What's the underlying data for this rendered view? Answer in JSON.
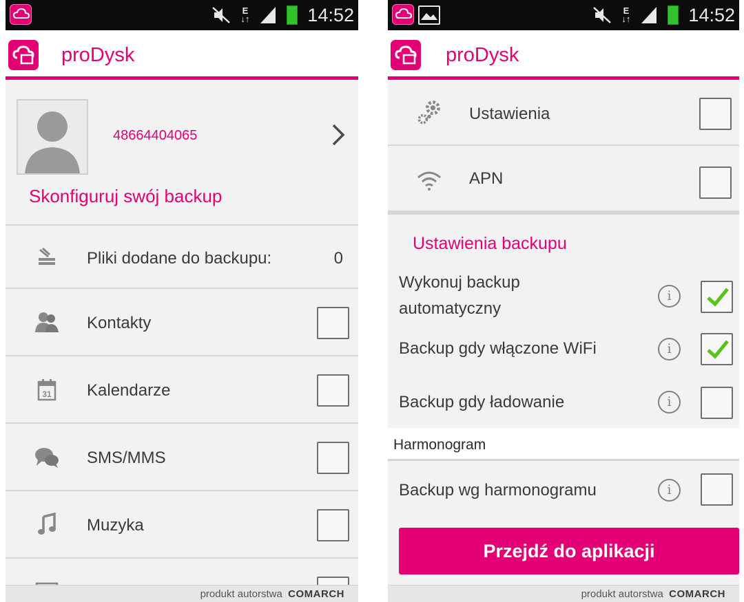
{
  "colors": {
    "accent": "#e20074",
    "background": "#f2f2f2",
    "text": "#3a3a3a",
    "check": "#5ac21a"
  },
  "status_bar": {
    "time": "14:52",
    "network_type": "E",
    "icons": [
      "prodysk-notification-icon",
      "mute-icon",
      "data-arrows-icon",
      "signal-icon",
      "battery-icon"
    ]
  },
  "left_screen": {
    "app_title": "proDysk",
    "profile": {
      "phone_number": "48664404065",
      "config_title": "Skonfiguruj swój backup"
    },
    "files_row": {
      "label": "Pliki dodane do backupu:",
      "count": "0",
      "icon": "files-icon"
    },
    "items": [
      {
        "label": "Kontakty",
        "icon": "contacts-icon",
        "checked": false
      },
      {
        "label": "Kalendarze",
        "icon": "calendar-icon",
        "checked": false
      },
      {
        "label": "SMS/MMS",
        "icon": "messages-icon",
        "checked": false
      },
      {
        "label": "Muzyka",
        "icon": "music-icon",
        "checked": false
      }
    ],
    "footer": {
      "prefix": "produkt autorstwa",
      "brand": "COMARCH"
    }
  },
  "right_screen": {
    "app_title": "proDysk",
    "items": [
      {
        "label": "Ustawienia",
        "icon": "gears-icon",
        "checked": false
      },
      {
        "label": "APN",
        "icon": "wifi-icon",
        "checked": false
      }
    ],
    "backup_settings_title": "Ustawienia backupu",
    "backup_settings": [
      {
        "label": "Wykonuj backup automatyczny",
        "checked": true
      },
      {
        "label": "Backup gdy włączone WiFi",
        "checked": true
      },
      {
        "label": "Backup gdy ładowanie",
        "checked": false
      }
    ],
    "harmonogram_title": "Harmonogram",
    "harmonogram_setting": {
      "label": "Backup wg harmonogramu",
      "checked": false
    },
    "go_button": "Przejdź do aplikacji",
    "footer": {
      "prefix": "produkt autorstwa",
      "brand": "COMARCH"
    }
  }
}
